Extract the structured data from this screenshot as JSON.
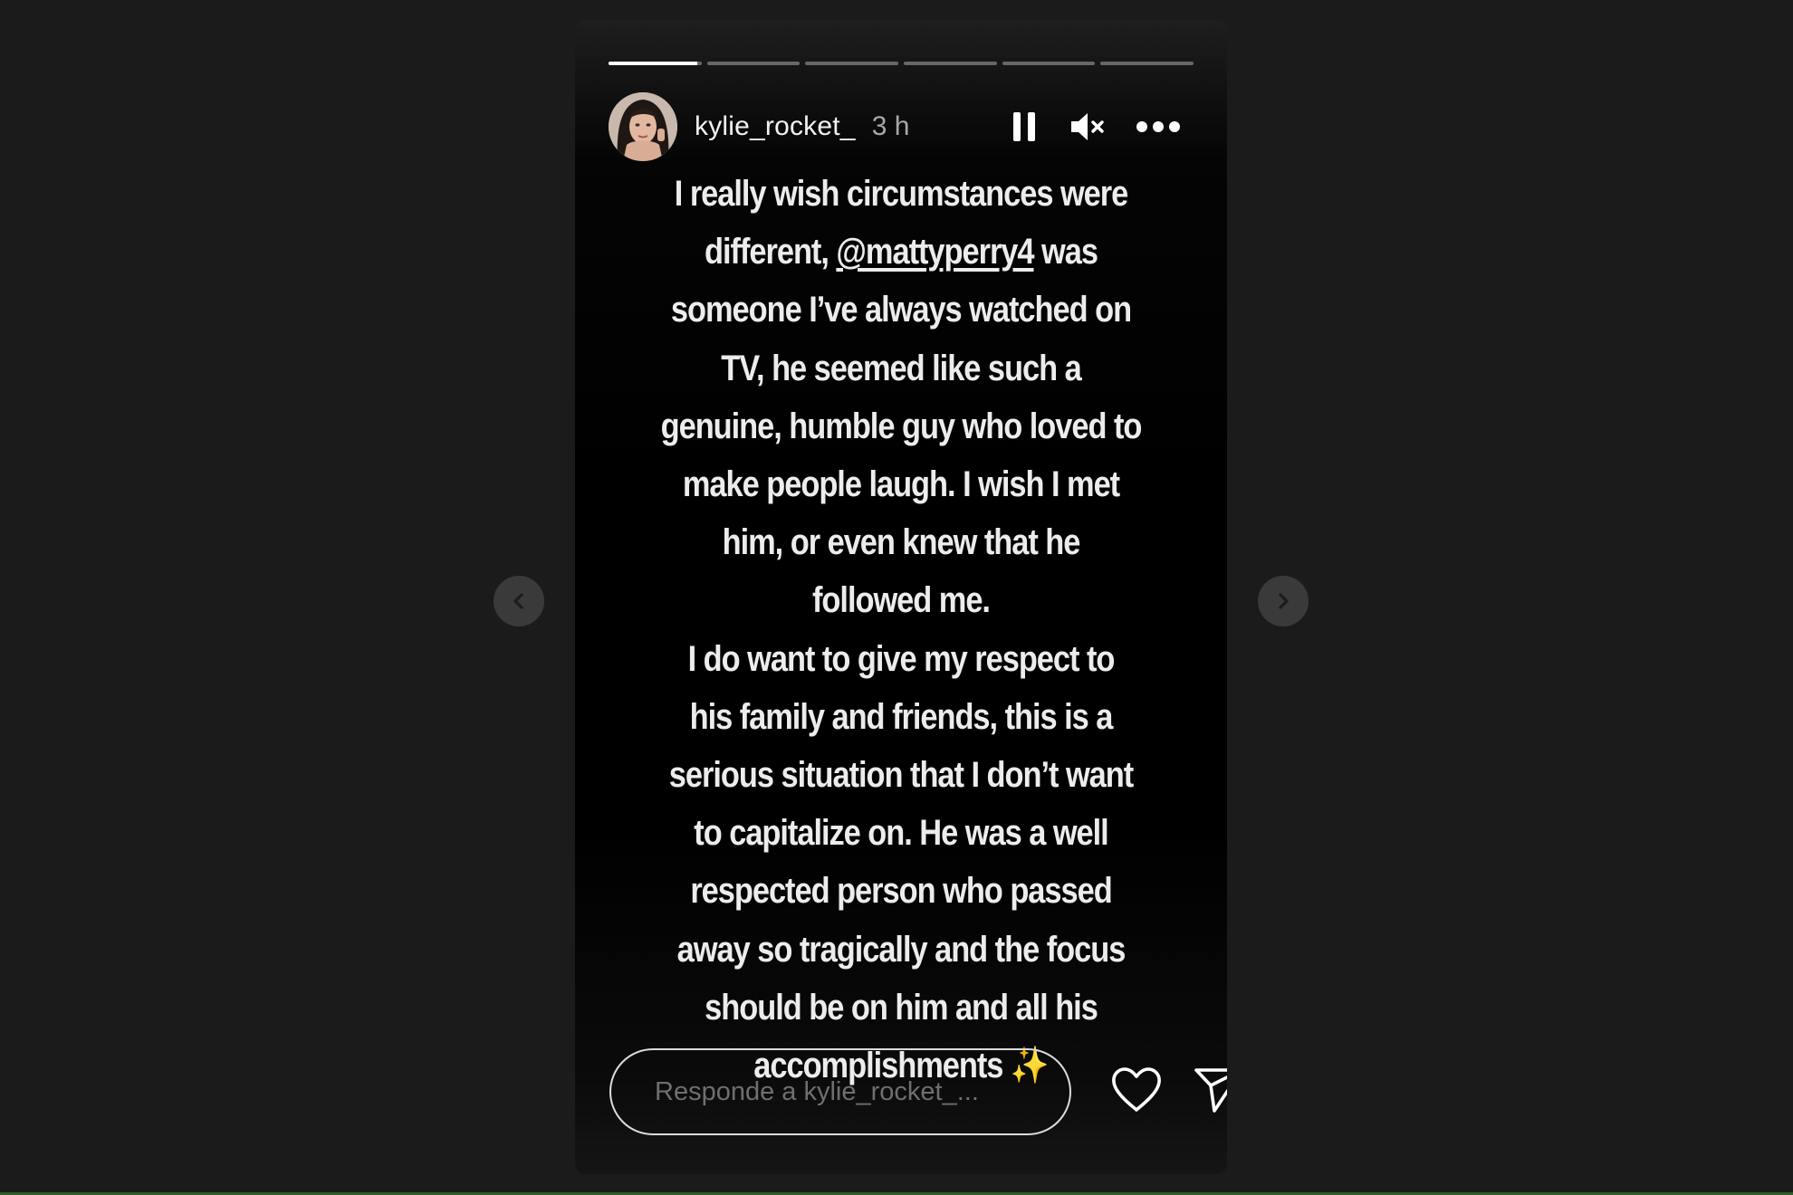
{
  "story": {
    "progress": {
      "segment_count": 6,
      "active_index": 0,
      "active_fraction": 0.95
    },
    "header": {
      "username": "kylie_rocket_",
      "timestamp": "3 h",
      "controls": {
        "pause": "pause-icon",
        "mute": "muted-speaker-icon",
        "more": "more-options-icon"
      }
    },
    "caption": {
      "lines": [
        "I really wish circumstances were",
        "different, @mattyperry4 was",
        "someone I’ve always watched on",
        "TV, he seemed like such a",
        "genuine, humble guy who loved to",
        "make people laugh. I wish I met",
        "him, or even knew that he",
        "followed me.",
        "I do want to give my respect to",
        "his family and friends, this is a",
        "serious situation that I don’t want",
        "to capitalize on. He was a well",
        "respected person who passed",
        "away so tragically and the focus",
        "should be on him and all his",
        "accomplishments ✨"
      ],
      "mention": "@mattyperry4"
    },
    "reply": {
      "placeholder": "Responde a kylie_rocket_..."
    },
    "actions": {
      "like": "heart-icon",
      "share": "send-icon"
    }
  },
  "navigation": {
    "prev": "chevron-left-icon",
    "next": "chevron-right-icon"
  },
  "colors": {
    "background": "#1b1b1b",
    "story_background": "#000000",
    "text": "#ececec",
    "muted_text": "#a8a8a8",
    "sparkle": "#e9cf6a"
  }
}
